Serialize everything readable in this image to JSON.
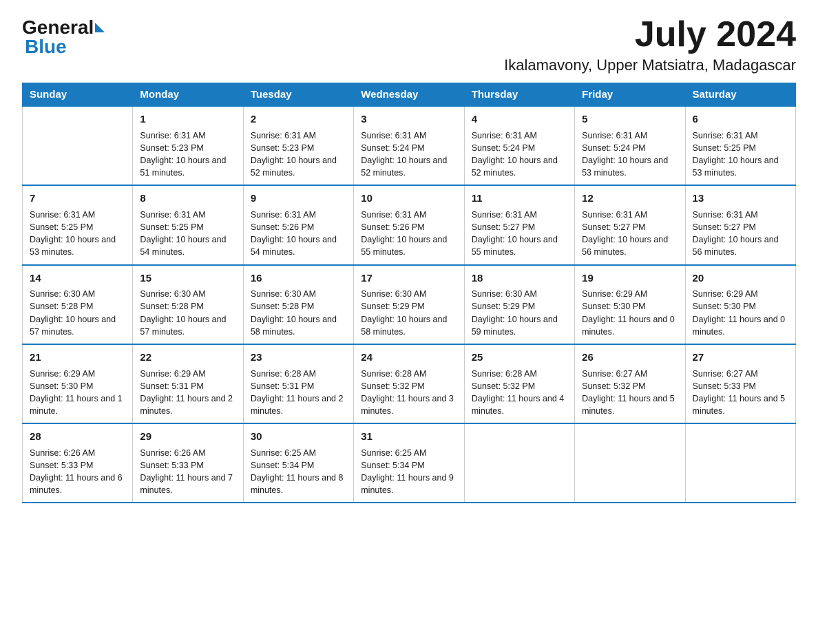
{
  "header": {
    "logo_general": "General",
    "logo_blue": "Blue",
    "month_title": "July 2024",
    "location": "Ikalamavony, Upper Matsiatra, Madagascar"
  },
  "days_of_week": [
    "Sunday",
    "Monday",
    "Tuesday",
    "Wednesday",
    "Thursday",
    "Friday",
    "Saturday"
  ],
  "weeks": [
    [
      {
        "day": "",
        "sunrise": "",
        "sunset": "",
        "daylight": ""
      },
      {
        "day": "1",
        "sunrise": "Sunrise: 6:31 AM",
        "sunset": "Sunset: 5:23 PM",
        "daylight": "Daylight: 10 hours and 51 minutes."
      },
      {
        "day": "2",
        "sunrise": "Sunrise: 6:31 AM",
        "sunset": "Sunset: 5:23 PM",
        "daylight": "Daylight: 10 hours and 52 minutes."
      },
      {
        "day": "3",
        "sunrise": "Sunrise: 6:31 AM",
        "sunset": "Sunset: 5:24 PM",
        "daylight": "Daylight: 10 hours and 52 minutes."
      },
      {
        "day": "4",
        "sunrise": "Sunrise: 6:31 AM",
        "sunset": "Sunset: 5:24 PM",
        "daylight": "Daylight: 10 hours and 52 minutes."
      },
      {
        "day": "5",
        "sunrise": "Sunrise: 6:31 AM",
        "sunset": "Sunset: 5:24 PM",
        "daylight": "Daylight: 10 hours and 53 minutes."
      },
      {
        "day": "6",
        "sunrise": "Sunrise: 6:31 AM",
        "sunset": "Sunset: 5:25 PM",
        "daylight": "Daylight: 10 hours and 53 minutes."
      }
    ],
    [
      {
        "day": "7",
        "sunrise": "Sunrise: 6:31 AM",
        "sunset": "Sunset: 5:25 PM",
        "daylight": "Daylight: 10 hours and 53 minutes."
      },
      {
        "day": "8",
        "sunrise": "Sunrise: 6:31 AM",
        "sunset": "Sunset: 5:25 PM",
        "daylight": "Daylight: 10 hours and 54 minutes."
      },
      {
        "day": "9",
        "sunrise": "Sunrise: 6:31 AM",
        "sunset": "Sunset: 5:26 PM",
        "daylight": "Daylight: 10 hours and 54 minutes."
      },
      {
        "day": "10",
        "sunrise": "Sunrise: 6:31 AM",
        "sunset": "Sunset: 5:26 PM",
        "daylight": "Daylight: 10 hours and 55 minutes."
      },
      {
        "day": "11",
        "sunrise": "Sunrise: 6:31 AM",
        "sunset": "Sunset: 5:27 PM",
        "daylight": "Daylight: 10 hours and 55 minutes."
      },
      {
        "day": "12",
        "sunrise": "Sunrise: 6:31 AM",
        "sunset": "Sunset: 5:27 PM",
        "daylight": "Daylight: 10 hours and 56 minutes."
      },
      {
        "day": "13",
        "sunrise": "Sunrise: 6:31 AM",
        "sunset": "Sunset: 5:27 PM",
        "daylight": "Daylight: 10 hours and 56 minutes."
      }
    ],
    [
      {
        "day": "14",
        "sunrise": "Sunrise: 6:30 AM",
        "sunset": "Sunset: 5:28 PM",
        "daylight": "Daylight: 10 hours and 57 minutes."
      },
      {
        "day": "15",
        "sunrise": "Sunrise: 6:30 AM",
        "sunset": "Sunset: 5:28 PM",
        "daylight": "Daylight: 10 hours and 57 minutes."
      },
      {
        "day": "16",
        "sunrise": "Sunrise: 6:30 AM",
        "sunset": "Sunset: 5:28 PM",
        "daylight": "Daylight: 10 hours and 58 minutes."
      },
      {
        "day": "17",
        "sunrise": "Sunrise: 6:30 AM",
        "sunset": "Sunset: 5:29 PM",
        "daylight": "Daylight: 10 hours and 58 minutes."
      },
      {
        "day": "18",
        "sunrise": "Sunrise: 6:30 AM",
        "sunset": "Sunset: 5:29 PM",
        "daylight": "Daylight: 10 hours and 59 minutes."
      },
      {
        "day": "19",
        "sunrise": "Sunrise: 6:29 AM",
        "sunset": "Sunset: 5:30 PM",
        "daylight": "Daylight: 11 hours and 0 minutes."
      },
      {
        "day": "20",
        "sunrise": "Sunrise: 6:29 AM",
        "sunset": "Sunset: 5:30 PM",
        "daylight": "Daylight: 11 hours and 0 minutes."
      }
    ],
    [
      {
        "day": "21",
        "sunrise": "Sunrise: 6:29 AM",
        "sunset": "Sunset: 5:30 PM",
        "daylight": "Daylight: 11 hours and 1 minute."
      },
      {
        "day": "22",
        "sunrise": "Sunrise: 6:29 AM",
        "sunset": "Sunset: 5:31 PM",
        "daylight": "Daylight: 11 hours and 2 minutes."
      },
      {
        "day": "23",
        "sunrise": "Sunrise: 6:28 AM",
        "sunset": "Sunset: 5:31 PM",
        "daylight": "Daylight: 11 hours and 2 minutes."
      },
      {
        "day": "24",
        "sunrise": "Sunrise: 6:28 AM",
        "sunset": "Sunset: 5:32 PM",
        "daylight": "Daylight: 11 hours and 3 minutes."
      },
      {
        "day": "25",
        "sunrise": "Sunrise: 6:28 AM",
        "sunset": "Sunset: 5:32 PM",
        "daylight": "Daylight: 11 hours and 4 minutes."
      },
      {
        "day": "26",
        "sunrise": "Sunrise: 6:27 AM",
        "sunset": "Sunset: 5:32 PM",
        "daylight": "Daylight: 11 hours and 5 minutes."
      },
      {
        "day": "27",
        "sunrise": "Sunrise: 6:27 AM",
        "sunset": "Sunset: 5:33 PM",
        "daylight": "Daylight: 11 hours and 5 minutes."
      }
    ],
    [
      {
        "day": "28",
        "sunrise": "Sunrise: 6:26 AM",
        "sunset": "Sunset: 5:33 PM",
        "daylight": "Daylight: 11 hours and 6 minutes."
      },
      {
        "day": "29",
        "sunrise": "Sunrise: 6:26 AM",
        "sunset": "Sunset: 5:33 PM",
        "daylight": "Daylight: 11 hours and 7 minutes."
      },
      {
        "day": "30",
        "sunrise": "Sunrise: 6:25 AM",
        "sunset": "Sunset: 5:34 PM",
        "daylight": "Daylight: 11 hours and 8 minutes."
      },
      {
        "day": "31",
        "sunrise": "Sunrise: 6:25 AM",
        "sunset": "Sunset: 5:34 PM",
        "daylight": "Daylight: 11 hours and 9 minutes."
      },
      {
        "day": "",
        "sunrise": "",
        "sunset": "",
        "daylight": ""
      },
      {
        "day": "",
        "sunrise": "",
        "sunset": "",
        "daylight": ""
      },
      {
        "day": "",
        "sunrise": "",
        "sunset": "",
        "daylight": ""
      }
    ]
  ]
}
